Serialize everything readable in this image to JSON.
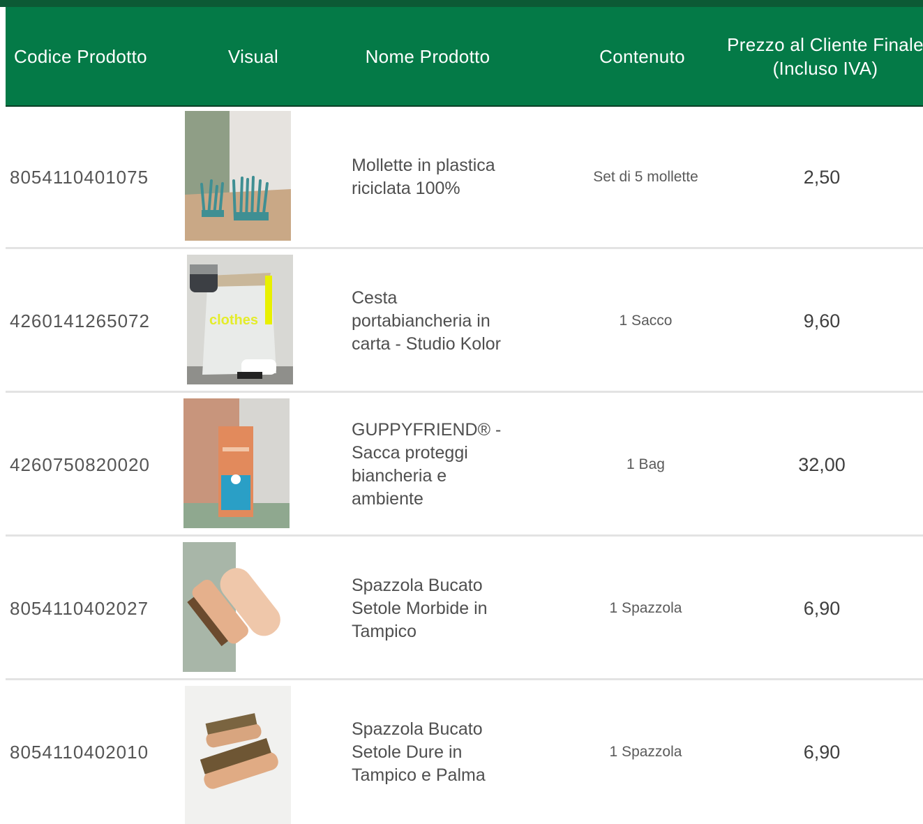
{
  "header": {
    "code": "Codice Prodotto",
    "visual": "Visual",
    "name": "Nome Prodotto",
    "content": "Contenuto",
    "price": "Prezzo al Cliente Finale\n(Incluso IVA)"
  },
  "products": [
    {
      "code": "8054110401075",
      "name": "Mollette in plastica riciclata 100%",
      "content": "Set di 5 mollette",
      "price": "2,50",
      "image": "clothespins-image"
    },
    {
      "code": "4260141265072",
      "name": "Cesta portabiancheria in carta - Studio Kolor",
      "content": "1 Sacco",
      "price": "9,60",
      "image": "laundry-bag-image",
      "image_label": "clothes"
    },
    {
      "code": "4260750820020",
      "name": "GUPPYFRIEND® - Sacca proteggi biancheria e ambiente",
      "content": "1 Bag",
      "price": "32,00",
      "image": "wash-bag-box-image"
    },
    {
      "code": "8054110402027",
      "name": "Spazzola Bucato Setole Morbide in Tampico",
      "content": "1 Spazzola",
      "price": "6,90",
      "image": "soft-brush-image"
    },
    {
      "code": "8054110402010",
      "name": "Spazzola Bucato Setole Dure in Tampico e Palma",
      "content": "1 Spazzola",
      "price": "6,90",
      "image": "hard-brush-image"
    }
  ],
  "colors": {
    "header_bg": "#047a47",
    "header_text": "#ffffff",
    "separator": "#e3e3e3"
  }
}
